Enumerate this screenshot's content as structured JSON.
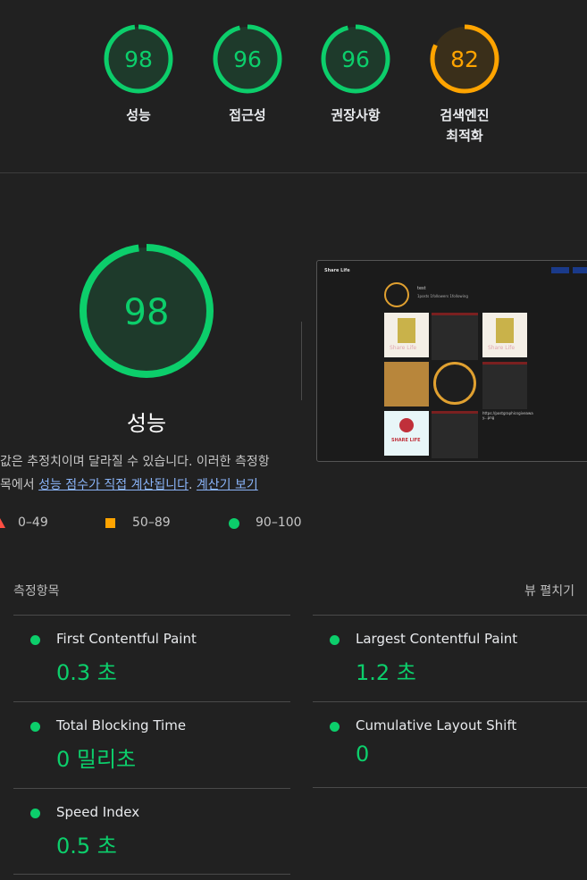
{
  "summary": {
    "categories": [
      {
        "label": "성능",
        "score": "98",
        "fraction": 0.98,
        "color": "#0cce6b"
      },
      {
        "label": "접근성",
        "score": "96",
        "fraction": 0.96,
        "color": "#0cce6b"
      },
      {
        "label": "권장사항",
        "score": "96",
        "fraction": 0.96,
        "color": "#0cce6b"
      },
      {
        "label": "검색엔진\n최적화",
        "label_line1": "검색엔진",
        "label_line2": "최적화",
        "score": "82",
        "fraction": 0.82,
        "color": "#ffa400"
      }
    ]
  },
  "performance": {
    "score": "98",
    "fraction": 0.98,
    "label": "성능",
    "desc_line1": "값은 추정치이며 달라질 수 있습니다. 이러한 측정항",
    "desc_line2_prefix": "목에서 ",
    "desc_link1": "성능 점수가 직접 계산됩니다",
    "desc_sep": ". ",
    "desc_link2": "계산기 보기",
    "legend": {
      "fail": "0–49",
      "average": "50–89",
      "pass": "90–100"
    }
  },
  "screenshot": {
    "site_title": "Share Life",
    "profile_name": "test",
    "stats": "1posts  1followers  1following",
    "brand_text": "Share Life",
    "brand_text2": "SHARE LIFE",
    "url_snippet": "https://postgraphicsgiveaway...png"
  },
  "metrics": {
    "title": "측정항목",
    "expand_label": "뷰 펼치기",
    "items": [
      {
        "name": "First Contentful Paint",
        "value": "0.3 초"
      },
      {
        "name": "Largest Contentful Paint",
        "value": "1.2 초"
      },
      {
        "name": "Total Blocking Time",
        "value": "0 밀리초"
      },
      {
        "name": "Cumulative Layout Shift",
        "value": "0"
      },
      {
        "name": "Speed Index",
        "value": "0.5 초"
      }
    ]
  }
}
